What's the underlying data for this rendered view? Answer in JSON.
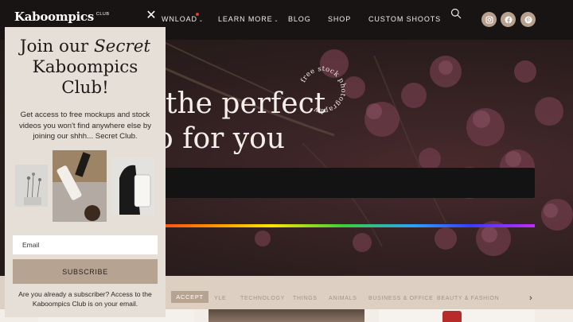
{
  "header": {
    "logo_text": "Kaboompics",
    "logo_superscript": "CLUB",
    "nav": [
      {
        "label": "WNLOAD",
        "has_caret": true,
        "has_dot": true
      },
      {
        "label": "LEARN MORE",
        "has_caret": true
      },
      {
        "label": "BLOG"
      },
      {
        "label": "SHOP"
      },
      {
        "label": "CUSTOM SHOOTS"
      }
    ],
    "caret": "⌄",
    "icons": [
      "search-icon",
      "instagram-icon",
      "facebook-icon",
      "pinterest-icon"
    ],
    "social_color": "#b8a08e"
  },
  "hero": {
    "title_line1": "the perfect",
    "title_line2": "o for you",
    "badge_text": "free stock photography"
  },
  "categories": {
    "active": "ACCEPT",
    "items": [
      "YLE",
      "TECHNOLOGY",
      "THINGS",
      "ANIMALS",
      "BUSINESS & OFFICE",
      "BEAUTY & FASHION"
    ]
  },
  "popup": {
    "title_line1_plain": "Join our ",
    "title_line1_italic": "Secret",
    "title_line2": "Kaboompics",
    "title_line3": "Club!",
    "description": "Get access to free mockups and stock videos you won't find anywhere else by joining our shhh... Secret Club.",
    "email_placeholder": "Email",
    "subscribe_label": "SUBSCRIBE",
    "footer": "Are you already a subscriber? Access to the Kaboompics Club is on your email.",
    "close_symbol": "✕",
    "accent": "#b6a391",
    "background": "#e6dfd7"
  }
}
